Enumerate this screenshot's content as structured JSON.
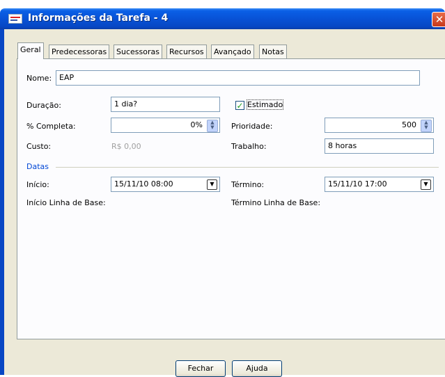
{
  "window": {
    "title": "Informações da Tarefa - 4"
  },
  "tabs": [
    "Geral",
    "Predecessoras",
    "Sucessoras",
    "Recursos",
    "Avançado",
    "Notas"
  ],
  "form": {
    "nome_label": "Nome:",
    "nome_value": "EAP",
    "duracao_label": "Duração:",
    "duracao_value": "1 dia?",
    "estimado_label": "Estimado",
    "estimado_checked": true,
    "completa_label": "% Completa:",
    "completa_value": "0%",
    "prioridade_label": "Prioridade:",
    "prioridade_value": "500",
    "custo_label": "Custo:",
    "custo_value": "R$ 0,00",
    "trabalho_label": "Trabalho:",
    "trabalho_value": "8 horas"
  },
  "datas": {
    "legend": "Datas",
    "inicio_label": "Início:",
    "inicio_value": "15/11/10 08:00",
    "termino_label": "Término:",
    "termino_value": "15/11/10 17:00",
    "inicio_base_label": "Início Linha de Base:",
    "termino_base_label": "Término Linha de Base:"
  },
  "buttons": {
    "fechar": "Fechar",
    "ajuda": "Ajuda"
  },
  "colors": {
    "titlebar": "#0852d6",
    "dialog_bg": "#ece9d8",
    "accent_legend": "#0046d5",
    "disabled_text": "#a0a0a0"
  },
  "icons": {
    "app": "app-icon",
    "close": "close-icon",
    "spinner": "spinner-arrows-icon",
    "dropdown": "chevron-down-icon",
    "check": "checkmark-icon"
  }
}
